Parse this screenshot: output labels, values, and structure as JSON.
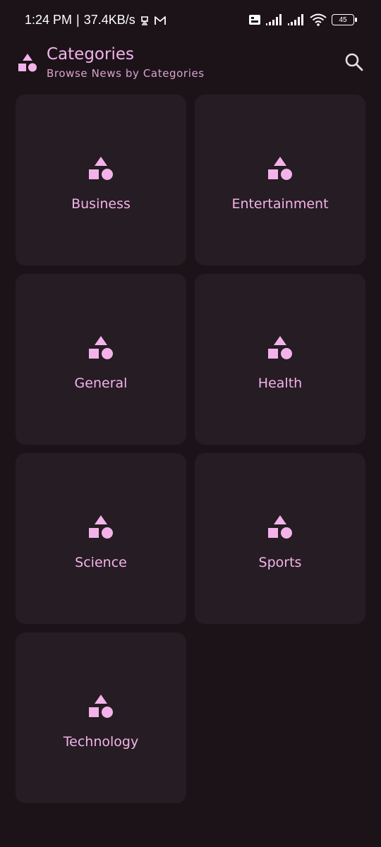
{
  "status_bar": {
    "time": "1:24 PM",
    "separator": "|",
    "network_speed": "37.4KB/s",
    "battery_level": "45",
    "icons": [
      "notification-icon",
      "gmail-icon",
      "volte-icon",
      "signal-icon",
      "signal-icon",
      "wifi-icon",
      "battery-icon"
    ]
  },
  "header": {
    "title": "Categories",
    "subtitle": "Browse News by Categories",
    "logo_icon": "shapes-icon",
    "search_icon": "search-icon"
  },
  "categories": [
    {
      "label": "Business",
      "icon": "shapes-icon"
    },
    {
      "label": "Entertainment",
      "icon": "shapes-icon"
    },
    {
      "label": "General",
      "icon": "shapes-icon"
    },
    {
      "label": "Health",
      "icon": "shapes-icon"
    },
    {
      "label": "Science",
      "icon": "shapes-icon"
    },
    {
      "label": "Sports",
      "icon": "shapes-icon"
    },
    {
      "label": "Technology",
      "icon": "shapes-icon"
    }
  ],
  "colors": {
    "background": "#1c1318",
    "card": "#261c23",
    "accent": "#f3b3ea"
  }
}
